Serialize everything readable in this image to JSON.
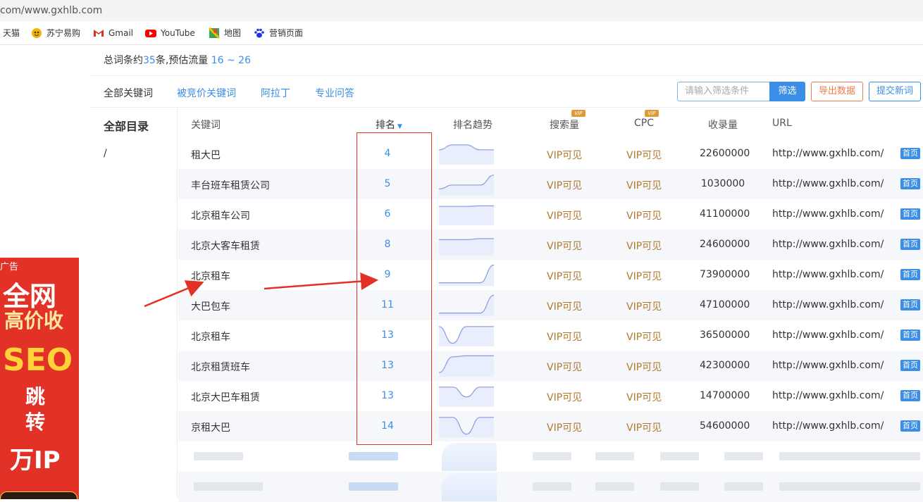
{
  "browser": {
    "url": "com/www.gxhlb.com",
    "bookmarks": [
      {
        "label": "天猫",
        "icon": "tmall-icon"
      },
      {
        "label": "苏宁易购",
        "icon": "suning-icon"
      },
      {
        "label": "Gmail",
        "icon": "gmail-icon"
      },
      {
        "label": "YouTube",
        "icon": "youtube-icon"
      },
      {
        "label": "地图",
        "icon": "maps-icon"
      },
      {
        "label": "营销页面",
        "icon": "baidu-paw-icon"
      }
    ]
  },
  "ad": {
    "label": "广告",
    "line1": "全网",
    "line2": "高价收",
    "line3": "SEO",
    "line4": "跳转",
    "line5": "万IP"
  },
  "summary": {
    "prefix": "总词条约",
    "count": "35",
    "middle": "条,预估流量",
    "traffic": "16 ~ 26"
  },
  "tabs": [
    "全部关键词",
    "被竞价关键词",
    "阿拉丁",
    "专业问答"
  ],
  "search": {
    "placeholder": "请输入筛选条件",
    "button": "筛选"
  },
  "actions": {
    "export": "导出数据",
    "submit": "提交新词"
  },
  "catalog": {
    "title": "全部目录",
    "item": "/"
  },
  "table": {
    "headers": {
      "keyword": "关键词",
      "rank": "排名",
      "trend": "排名趋势",
      "volume": "搜索量",
      "cpc": "CPC",
      "indexed": "收录量",
      "url": "URL"
    },
    "vip_badge": "VIP",
    "rows": [
      {
        "keyword": "租大巴",
        "rank": "4",
        "volume": "VIP可见",
        "cpc": "VIP可见",
        "indexed": "22600000",
        "url": "http://www.gxhlb.com/",
        "tag": "首页",
        "trend": [
          0.35,
          0.1,
          0.1,
          0.35,
          0.35
        ]
      },
      {
        "keyword": "丰台班车租赁公司",
        "rank": "5",
        "volume": "VIP可见",
        "cpc": "VIP可见",
        "indexed": "1030000",
        "url": "http://www.gxhlb.com/",
        "tag": "首页",
        "trend": [
          0.8,
          0.6,
          0.6,
          0.6,
          0.1
        ]
      },
      {
        "keyword": "北京租车公司",
        "rank": "6",
        "volume": "VIP可见",
        "cpc": "VIP可见",
        "indexed": "41100000",
        "url": "http://www.gxhlb.com/",
        "tag": "首页",
        "trend": [
          0.15,
          0.15,
          0.15,
          0.12,
          0.12
        ]
      },
      {
        "keyword": "北京大客车租赁",
        "rank": "8",
        "volume": "VIP可见",
        "cpc": "VIP可见",
        "indexed": "24600000",
        "url": "http://www.gxhlb.com/",
        "tag": "首页",
        "trend": [
          0.3,
          0.3,
          0.3,
          0.25,
          0.25
        ]
      },
      {
        "keyword": "北京租车",
        "rank": "9",
        "volume": "VIP可见",
        "cpc": "VIP可见",
        "indexed": "73900000",
        "url": "http://www.gxhlb.com/",
        "tag": "首页",
        "trend": [
          0.95,
          0.95,
          0.95,
          0.95,
          0.05
        ]
      },
      {
        "keyword": "大巴包车",
        "rank": "11",
        "volume": "VIP可见",
        "cpc": "VIP可见",
        "indexed": "47100000",
        "url": "http://www.gxhlb.com/",
        "tag": "首页",
        "trend": [
          0.95,
          0.95,
          0.95,
          0.95,
          0.05
        ]
      },
      {
        "keyword": "北京租车",
        "rank": "13",
        "volume": "VIP可见",
        "cpc": "VIP可见",
        "indexed": "36500000",
        "url": "http://www.gxhlb.com/",
        "tag": "首页",
        "trend": [
          0.1,
          0.95,
          0.1,
          0.1,
          0.1
        ]
      },
      {
        "keyword": "北京租赁班车",
        "rank": "13",
        "volume": "VIP可见",
        "cpc": "VIP可见",
        "indexed": "42300000",
        "url": "http://www.gxhlb.com/",
        "tag": "首页",
        "trend": [
          0.9,
          0.1,
          0.05,
          0.05,
          0.05
        ]
      },
      {
        "keyword": "北京大巴车租赁",
        "rank": "13",
        "volume": "VIP可见",
        "cpc": "VIP可见",
        "indexed": "14700000",
        "url": "http://www.gxhlb.com/",
        "tag": "首页",
        "trend": [
          0.1,
          0.1,
          0.6,
          0.1,
          0.1
        ]
      },
      {
        "keyword": "京租大巴",
        "rank": "14",
        "volume": "VIP可见",
        "cpc": "VIP可见",
        "indexed": "54600000",
        "url": "http://www.gxhlb.com/",
        "tag": "首页",
        "trend": [
          0.1,
          0.1,
          0.95,
          0.1,
          0.1
        ]
      }
    ]
  },
  "colors": {
    "accent": "#3a8ee6",
    "vip_text": "#b07a2c",
    "annotation": "#e23126"
  }
}
